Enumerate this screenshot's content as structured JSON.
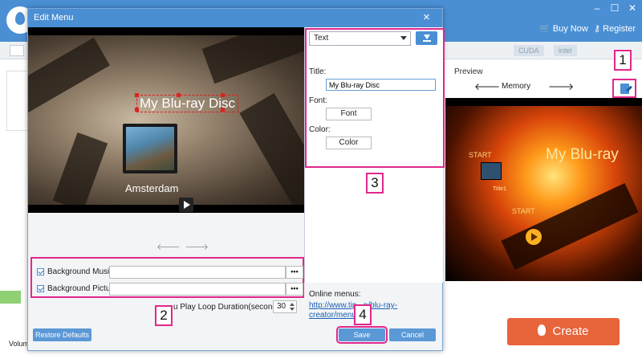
{
  "app": {
    "buy_now": "Buy Now",
    "register": "Register",
    "badges": [
      "CUDA",
      "intel"
    ],
    "preview_label": "Preview",
    "memory_label": "Memory",
    "preview_title": "My Blu-ray",
    "preview_start": "START",
    "preview_item": "Title1",
    "create_label": "Create",
    "volume_label": "Volume",
    "accent_color": "#4a8fd4",
    "create_color": "#e8643a",
    "callout_color": "#e0288c"
  },
  "dialog": {
    "title": "Edit Menu",
    "close": "×",
    "menu_title": "My Blu-ray Disc",
    "menu_caption": "Amsterdam",
    "type_select": "Text",
    "title_label": "Title:",
    "title_value": "My Blu-ray Disc",
    "font_label": "Font:",
    "font_button": "Font",
    "color_label": "Color:",
    "color_button": "Color",
    "bg_music_label": "Background Music:",
    "bg_picture_label": "Background Picture:",
    "browse_label": "•••",
    "loop_label": "u Play Loop Duration(seconds):",
    "loop_value": "30",
    "online_menus_label": "Online menus:",
    "online_link": "http://www.tip...n/blu-ray-creator/menu.h...",
    "restore_defaults": "Restore Defaults",
    "save": "Save",
    "cancel": "Cancel"
  },
  "callouts": [
    "1",
    "2",
    "3",
    "4"
  ]
}
